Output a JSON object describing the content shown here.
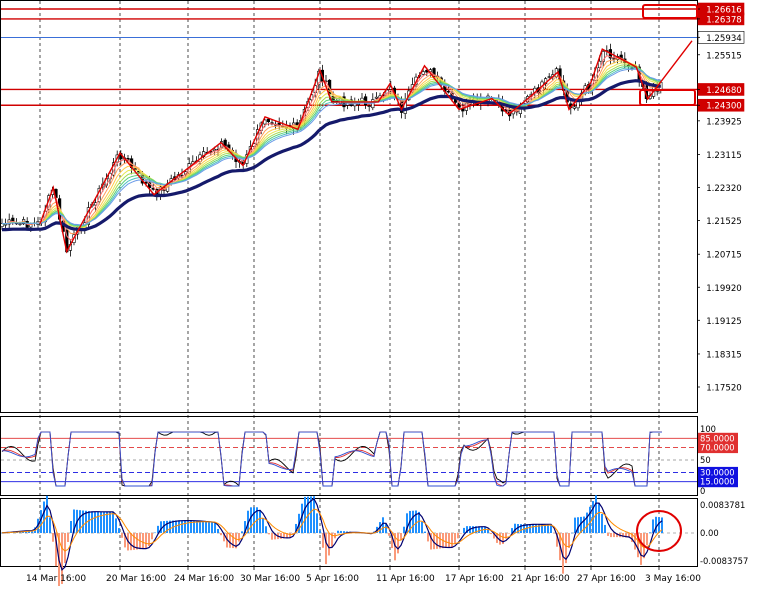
{
  "colors": {
    "background": "#ffffff",
    "axis": "#000000",
    "grid": "#000000",
    "candle_up": "#ffffff",
    "candle_down": "#000000",
    "resistance": "#d00000",
    "price_line": "#3a6fd8",
    "zigzag": "#e00000",
    "ma_slow": "#151a6b",
    "rsi_black": "#000000",
    "rsi_red": "#e03030",
    "rsi_blue": "#3050d0",
    "level_red": "#e03030",
    "level_blue": "#1010e0",
    "macd_pos": "#1e90ff",
    "macd_neg": "#fa9a7a",
    "macd_line": "#000070",
    "macd_signal": "#ff8c00",
    "annotation": "#e00000"
  },
  "chart_data": [
    {
      "type": "candlestick",
      "panel": "price",
      "y_ticks": [
        "1.26616",
        "1.26378",
        "1.25934",
        "1.25515",
        "1.24680",
        "1.24300",
        "1.23925",
        "1.23115",
        "1.22320",
        "1.21525",
        "1.20715",
        "1.19920",
        "1.19125",
        "1.18315",
        "1.17520"
      ],
      "highlight_labels": [
        "1.26616",
        "1.26378",
        "1.24680",
        "1.24300"
      ],
      "current_price_label": "1.25934",
      "x_tick_labels": [
        "14 Mar 16:00",
        "20 Mar 16:00",
        "24 Mar 16:00",
        "30 Mar 16:00",
        "5 Apr 16:00",
        "11 Apr 16:00",
        "17 Apr 16:00",
        "21 Apr 16:00",
        "27 Apr 16:00",
        "3 May 16:00"
      ],
      "horizontal_levels": [
        {
          "value": 1.26616,
          "color": "red"
        },
        {
          "value": 1.26378,
          "color": "red"
        },
        {
          "value": 1.2593,
          "color": "blue"
        },
        {
          "value": 1.2468,
          "color": "red"
        },
        {
          "value": 1.243,
          "color": "red"
        }
      ],
      "zigzag": [
        {
          "x": "14 Mar",
          "y": 1.2145
        },
        {
          "x": "15 Mar",
          "y": 1.2232
        },
        {
          "x": "16 Mar",
          "y": 1.2078
        },
        {
          "x": "20 Mar",
          "y": 1.2315
        },
        {
          "x": "22 Mar",
          "y": 1.2215
        },
        {
          "x": "27 Mar",
          "y": 1.234
        },
        {
          "x": "29 Mar",
          "y": 1.2285
        },
        {
          "x": "31 Mar",
          "y": 1.2402
        },
        {
          "x": "3 Apr",
          "y": 1.2372
        },
        {
          "x": "5 Apr",
          "y": 1.2514
        },
        {
          "x": "6 Apr",
          "y": 1.2438
        },
        {
          "x": "10 Apr",
          "y": 1.2438
        },
        {
          "x": "11 Apr",
          "y": 1.2482
        },
        {
          "x": "12 Apr",
          "y": 1.242
        },
        {
          "x": "14 Apr",
          "y": 1.2525
        },
        {
          "x": "17 Apr",
          "y": 1.242
        },
        {
          "x": "19 Apr",
          "y": 1.2446
        },
        {
          "x": "20 Apr",
          "y": 1.2408
        },
        {
          "x": "21 Apr",
          "y": 1.244
        },
        {
          "x": "24 Apr",
          "y": 1.251
        },
        {
          "x": "25 Apr",
          "y": 1.242
        },
        {
          "x": "27 Apr",
          "y": 1.2485
        },
        {
          "x": "28 Apr",
          "y": 1.2565
        },
        {
          "x": "1 May",
          "y": 1.2522
        },
        {
          "x": "2 May",
          "y": 1.2445
        },
        {
          "x": "5 May",
          "y": 1.2585
        }
      ]
    },
    {
      "type": "line",
      "panel": "stochastic",
      "y_ticks": [
        "100",
        "85.0000",
        "70.0000",
        "50",
        "30.0000",
        "15.0000",
        "0"
      ],
      "levels": [
        {
          "value": 85,
          "label": "85.0000",
          "color": "red"
        },
        {
          "value": 70,
          "label": "70.0000",
          "color": "red"
        },
        {
          "value": 30,
          "label": "30.0000",
          "color": "blue"
        },
        {
          "value": 15,
          "label": "15.0000",
          "color": "blue"
        }
      ],
      "ylim": [
        0,
        100
      ]
    },
    {
      "type": "bar",
      "panel": "macd",
      "y_ticks": [
        "0.0083781",
        "0.00",
        "-0.0083757"
      ],
      "ylim": [
        -0.0083757,
        0.0083781
      ]
    }
  ],
  "annotations": [
    {
      "shape": "rectangle",
      "near_level": "1.26616"
    },
    {
      "shape": "rectangle",
      "near_level": "1.24680"
    },
    {
      "shape": "ellipse",
      "panel": "macd"
    }
  ]
}
